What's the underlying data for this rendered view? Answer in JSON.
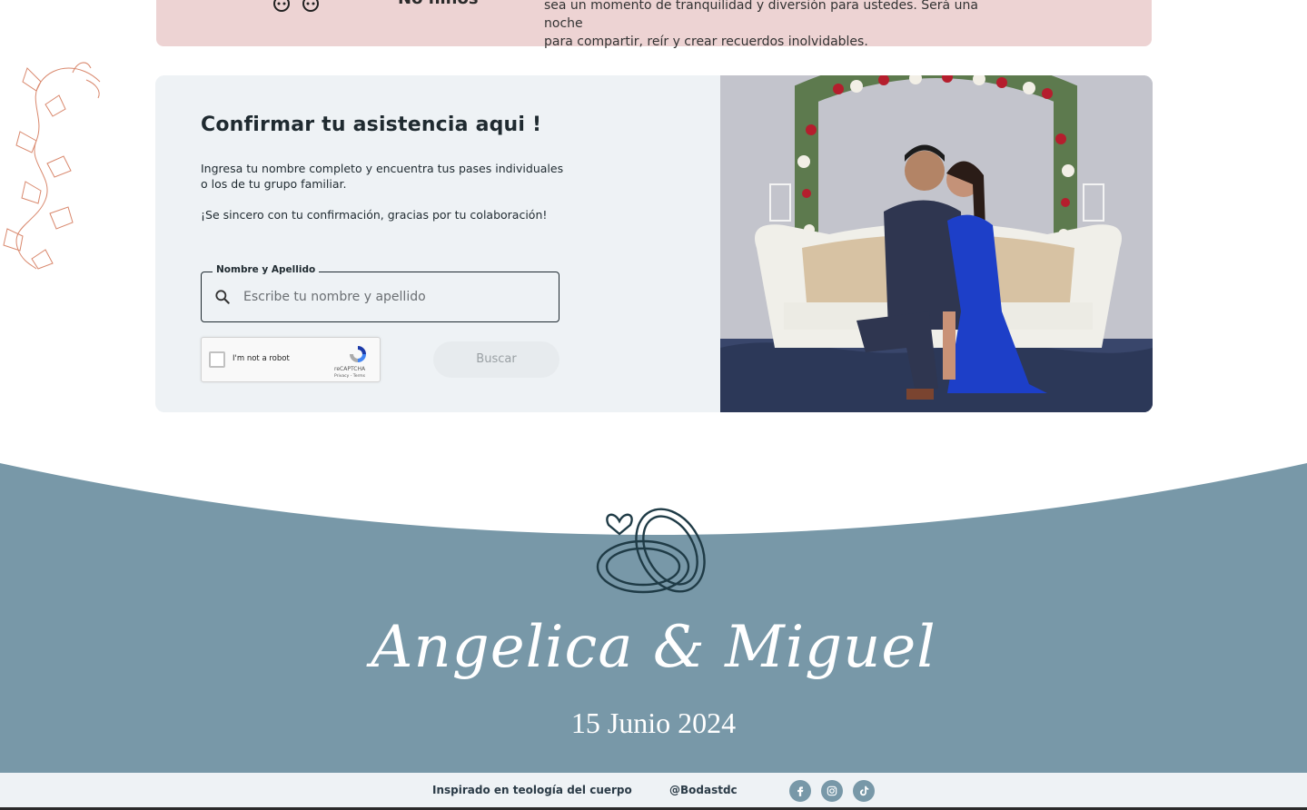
{
  "notice": {
    "title": "No niños",
    "description_line1": "sea un momento de tranquilidad y diversión para ustedes. Será una noche",
    "description_line2": "para compartir, reír y crear recuerdos inolvidables."
  },
  "rsvp": {
    "title": "Confirmar tu asistencia aqui !",
    "instructions": "Ingresa tu nombre completo y encuentra tus pases individuales o los de tu grupo familiar.",
    "sincerity_note": "¡Se sincero con tu confirmación, gracias por tu colaboración!",
    "field_label": "Nombre y Apellido",
    "field_placeholder": "Escribe tu nombre y apellido",
    "field_value": "",
    "captcha_label": "I'm not a robot",
    "captcha_brand": "reCAPTCHA",
    "captcha_terms": "Privacy - Terms",
    "search_button": "Buscar"
  },
  "hero": {
    "couple_names": "Angelica & Miguel",
    "date": "15 Junio 2024"
  },
  "footer": {
    "tagline": "Inspirado en teología del cuerpo",
    "handle": "@Bodastdc",
    "social_icons": [
      "facebook-icon",
      "instagram-icon",
      "tiktok-icon"
    ]
  },
  "colors": {
    "accent_blue": "#7898a8",
    "pink_band": "#edd3d3",
    "card_bg": "#eef2f5",
    "text_dark": "#1f2a30"
  }
}
